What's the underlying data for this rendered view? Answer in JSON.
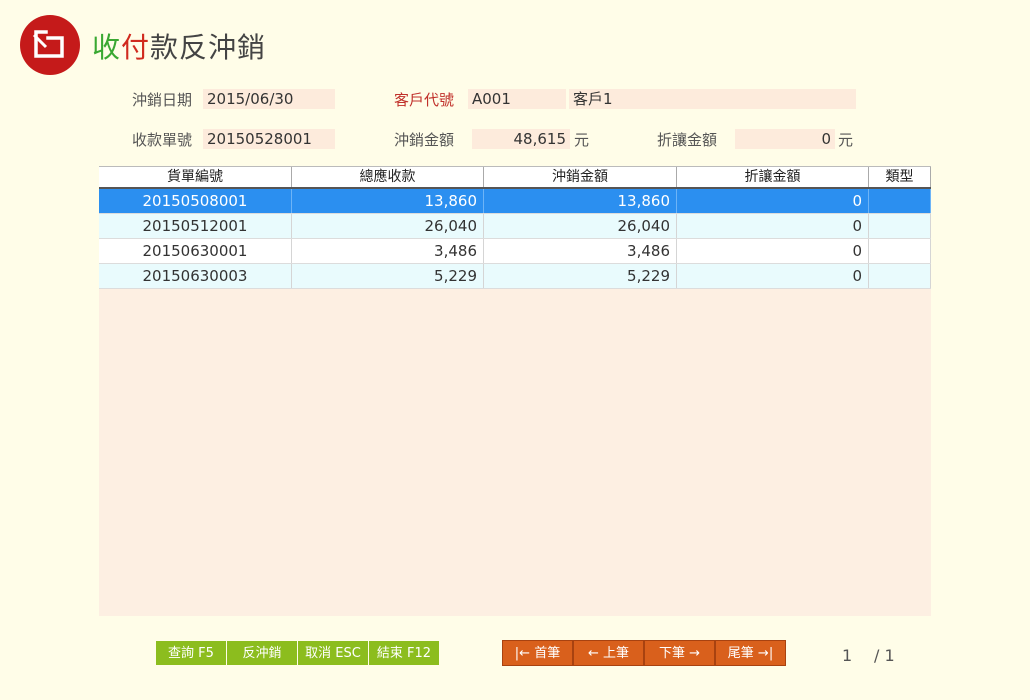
{
  "header": {
    "title_part1": "收",
    "title_part2": "付",
    "title_part3": "款反沖銷"
  },
  "form": {
    "date_label": "沖銷日期",
    "date_value": "2015/06/30",
    "customer_code_label": "客戶代號",
    "customer_code_value": "A001",
    "customer_name_value": "客戶1",
    "receipt_no_label": "收款單號",
    "receipt_no_value": "20150528001",
    "writeoff_amount_label": "沖銷金額",
    "writeoff_amount_value": "48,615",
    "writeoff_unit": "元",
    "discount_label": "折讓金額",
    "discount_value": "0",
    "discount_unit": "元"
  },
  "table": {
    "columns": [
      "貨單編號",
      "總應收款",
      "沖銷金額",
      "折讓金額",
      "類型"
    ],
    "rows": [
      [
        "20150508001",
        "13,860",
        "13,860",
        "0",
        ""
      ],
      [
        "20150512001",
        "26,040",
        "26,040",
        "0",
        ""
      ],
      [
        "20150630001",
        "3,486",
        "3,486",
        "0",
        ""
      ],
      [
        "20150630003",
        "5,229",
        "5,229",
        "0",
        ""
      ]
    ],
    "selected_row": 0
  },
  "buttons": {
    "query": "查詢 F5",
    "reverse": "反沖銷",
    "cancel": "取消 ESC",
    "exit": "結束 F12",
    "first": "|← 首筆",
    "prev": "← 上筆",
    "next": "下筆 →",
    "last": "尾筆 →|"
  },
  "pager": {
    "current": "1",
    "total": "/ 1"
  },
  "colors": {
    "logo": "#c51a1a",
    "green_button": "#8cbd1e",
    "orange_button": "#d9601c",
    "selected_row": "#2b8ff0",
    "field_bg": "#fdebdc"
  }
}
